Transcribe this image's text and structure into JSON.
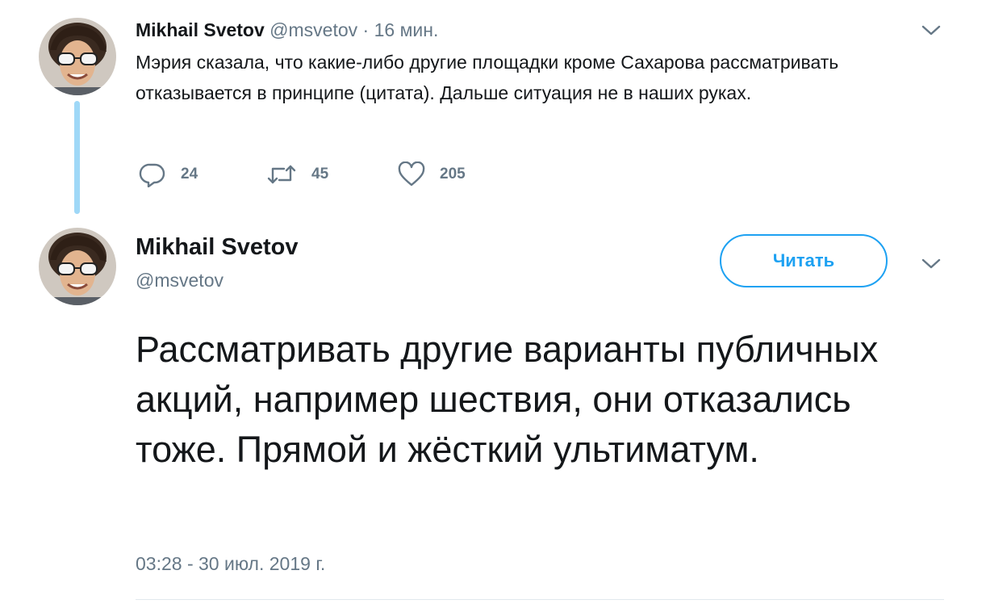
{
  "tweet1": {
    "author_name": "Mikhail Svetov",
    "handle": "@msvetov",
    "separator": "·",
    "time_ago": "16 мин.",
    "text": "Мэрия сказала, что какие-либо другие площадки кроме Сахарова рассматривать отказывается в принципе (цитата). Дальше ситуация не в наших руках.",
    "replies": "24",
    "retweets": "45",
    "likes": "205",
    "icons": {
      "avatar": "avatar-sunglasses-man",
      "reply": "reply-icon",
      "retweet": "retweet-icon",
      "like": "heart-icon",
      "menu": "chevron-down-icon"
    }
  },
  "tweet2": {
    "author_name": "Mikhail Svetov",
    "handle": "@msvetov",
    "follow_label": "Читать",
    "text": "Рассматривать другие варианты публичных акций, например шествия, они отказались тоже. Прямой и жёсткий ультиматум.",
    "timestamp": "03:28 - 30 июл. 2019 г.",
    "icons": {
      "avatar": "avatar-sunglasses-man",
      "menu": "chevron-down-icon"
    }
  },
  "colors": {
    "accent": "#1da1f2",
    "thread_line": "#9fd8f7",
    "muted_text": "#657786",
    "primary_text": "#14171a"
  }
}
